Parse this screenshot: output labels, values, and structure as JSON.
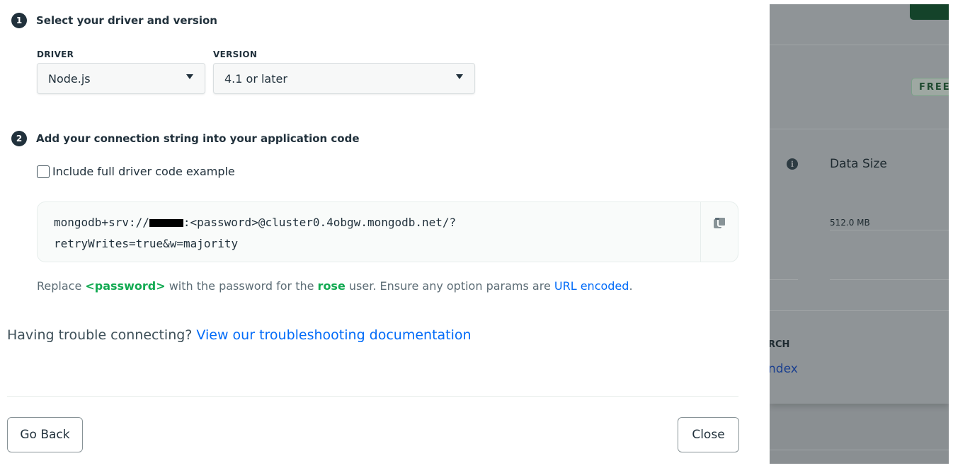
{
  "step1": {
    "number": "1",
    "title": "Select your driver and version",
    "driver_label": "DRIVER",
    "driver_value": "Node.js",
    "version_label": "VERSION",
    "version_value": "4.1 or later"
  },
  "step2": {
    "number": "2",
    "title": "Add your connection string into your application code",
    "checkbox_label": "Include full driver code example",
    "checkbox_checked": false,
    "connection_string": {
      "prefix": "mongodb+srv://",
      "suffix_line1": ":<password>@cluster0.4obgw.mongodb.net/?",
      "line2": "retryWrites=true&w=majority"
    },
    "note": {
      "text1": "Replace ",
      "password": "<password>",
      "text2": " with the password for the ",
      "user": "rose",
      "text3": " user. Ensure any option params are ",
      "link": "URL encoded",
      "text4": "."
    }
  },
  "trouble": {
    "text": "Having trouble connecting? ",
    "link": "View our troubleshooting documentation"
  },
  "buttons": {
    "back": "Go Back",
    "close": "Close"
  },
  "background": {
    "badge": "FREE",
    "data_size_label": "Data Size",
    "data_size_value": "512.0 MB",
    "search_partial": "RCH",
    "index_partial": "ndex"
  },
  "colors": {
    "accent_green": "#13aa52",
    "link_blue": "#016bf8",
    "text_dark": "#21313c"
  },
  "icons": {
    "copy": "copy-icon",
    "caret": "caret-down-icon",
    "info": "info-icon"
  }
}
